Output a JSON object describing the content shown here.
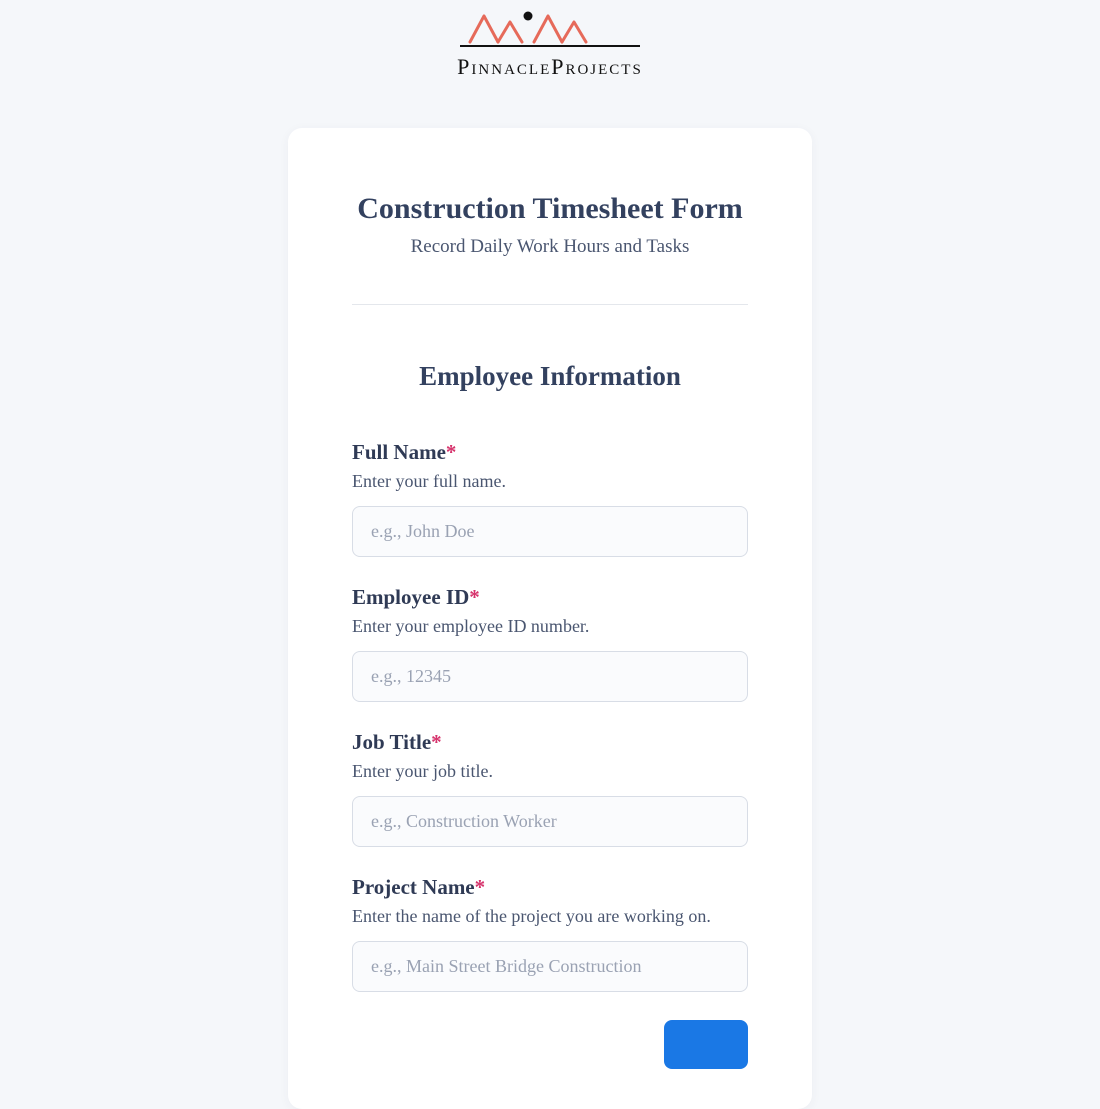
{
  "logo": {
    "brand_text": "PinnacleProjects"
  },
  "form": {
    "title": "Construction Timesheet Form",
    "subtitle": "Record Daily Work Hours and Tasks",
    "section_title": "Employee Information",
    "fields": {
      "full_name": {
        "label": "Full Name",
        "required_marker": "*",
        "description": "Enter your full name.",
        "placeholder": "e.g., John Doe"
      },
      "employee_id": {
        "label": "Employee ID",
        "required_marker": "*",
        "description": "Enter your employee ID number.",
        "placeholder": "e.g., 12345"
      },
      "job_title": {
        "label": "Job Title",
        "required_marker": "*",
        "description": "Enter your job title.",
        "placeholder": "e.g., Construction Worker"
      },
      "project_name": {
        "label": "Project Name",
        "required_marker": "*",
        "description": "Enter the name of the project you are working on.",
        "placeholder": "e.g., Main Street Bridge Construction"
      }
    }
  }
}
